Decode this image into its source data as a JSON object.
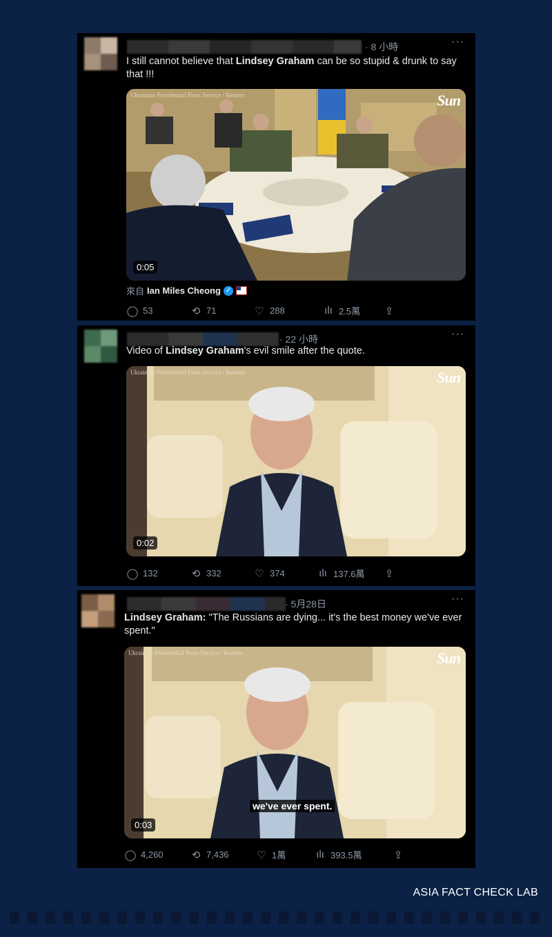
{
  "tweets": [
    {
      "timestamp": "· 8 小時",
      "more": "···",
      "text_prefix": "I still cannot believe that ",
      "text_bold": "Lindsey Graham",
      "text_suffix": " can be so stupid & drunk to say that !!!",
      "media": {
        "credit": "Ukrainian Presidential Press Service / Reuters",
        "brand": "Sun",
        "duration": "0:05"
      },
      "from": {
        "prefix": "來自",
        "name": "Ian Miles Cheong"
      },
      "actions": {
        "replies": "53",
        "retweets": "71",
        "likes": "288",
        "views": "2.5萬"
      }
    },
    {
      "timestamp": "· 22 小時",
      "more": "···",
      "text_prefix": "Video of ",
      "text_bold": "Lindsey Graham",
      "text_suffix": "'s evil smile after the quote.",
      "media": {
        "credit": "Ukrainian Presidential Press Service / Reuters",
        "brand": "Sun",
        "duration": "0:02"
      },
      "actions": {
        "replies": "132",
        "retweets": "332",
        "likes": "374",
        "views": "137.6萬"
      }
    },
    {
      "timestamp": "· 5月28日",
      "more": "···",
      "text_bold": "Lindsey Graham:",
      "text_suffix": " \"The Russians are dying... it's the best money we've ever spent.\"",
      "media": {
        "credit": "Ukrainian Presidential Press Service / Reuters",
        "brand": "Sun",
        "duration": "0:03",
        "subtitle": "we've ever spent."
      },
      "actions": {
        "replies": "4,260",
        "retweets": "7,436",
        "likes": "1萬",
        "views": "393.5萬"
      }
    }
  ],
  "icons": [
    "reply-icon",
    "retweet-icon",
    "like-icon",
    "views-icon",
    "share-icon",
    "verified-icon",
    "more-icon"
  ],
  "footer": {
    "brand": "ASIA FACT CHECK LAB"
  },
  "colors": {
    "background": "#0b2145",
    "card": "#000000",
    "muted": "#8b98a5",
    "verified": "#1d9bf0"
  }
}
